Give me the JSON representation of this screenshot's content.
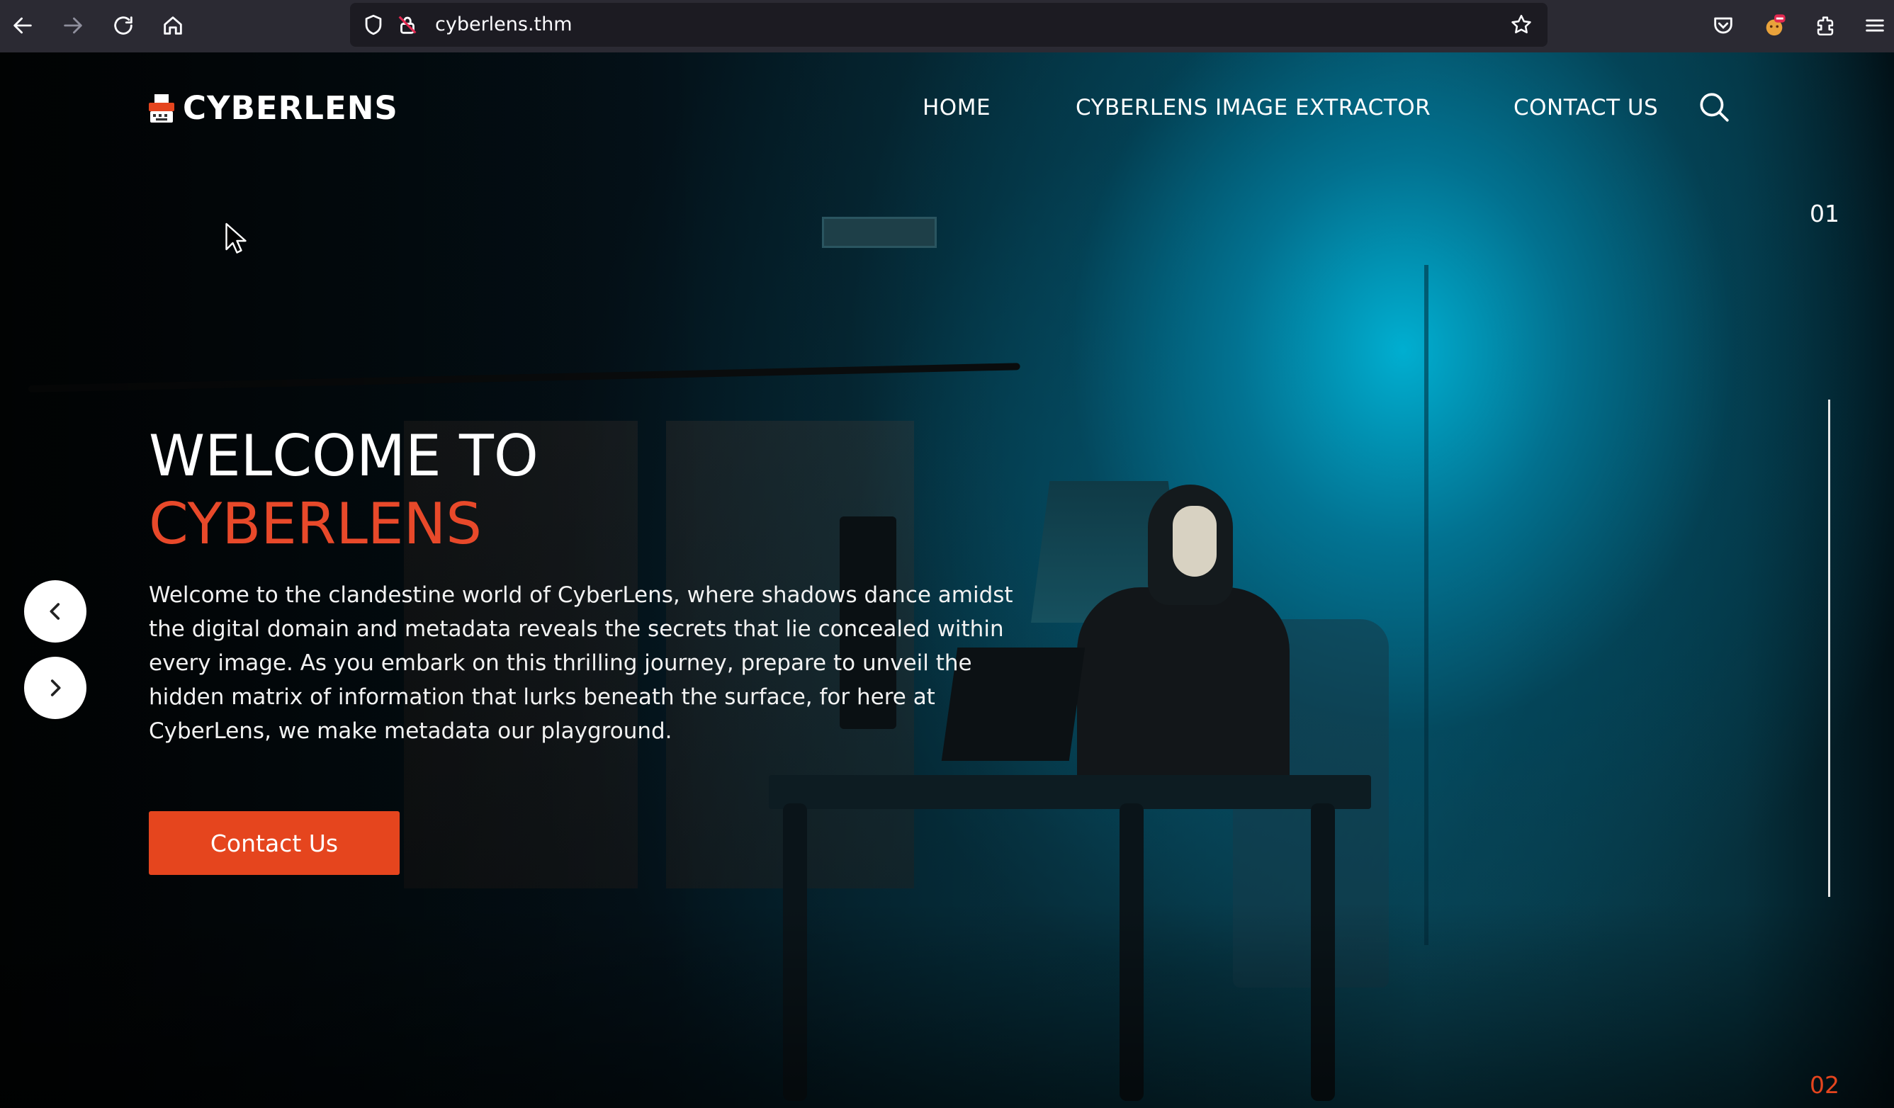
{
  "browser": {
    "url": "cyberlens.thm",
    "icons": [
      "back-icon",
      "forward-icon",
      "reload-icon",
      "home-icon",
      "shield-icon",
      "lock-icon",
      "star-icon",
      "pocket-icon",
      "extension-avatar-icon",
      "extensions-icon",
      "menu-icon"
    ]
  },
  "site": {
    "logo": "CYBERLENS",
    "nav": [
      "HOME",
      "CYBERLENS IMAGE EXTRACTOR",
      "CONTACT US"
    ]
  },
  "hero": {
    "title_line1": "WELCOME TO",
    "title_line2": "CYBERLENS",
    "description": "Welcome to the clandestine world of CyberLens, where shadows dance amidst the digital domain and metadata reveals the secrets that lie concealed within every image. As you embark on this thrilling journey, prepare to unveil the hidden matrix of information that lurks beneath the surface, for here at CyberLens, we make metadata our playground.",
    "cta_label": "Contact Us"
  },
  "slider": {
    "current": "01",
    "next": "02"
  },
  "colors": {
    "accent": "#e5451e",
    "chrome_bg": "#2b2a33",
    "url_bg": "#1c1b22"
  }
}
